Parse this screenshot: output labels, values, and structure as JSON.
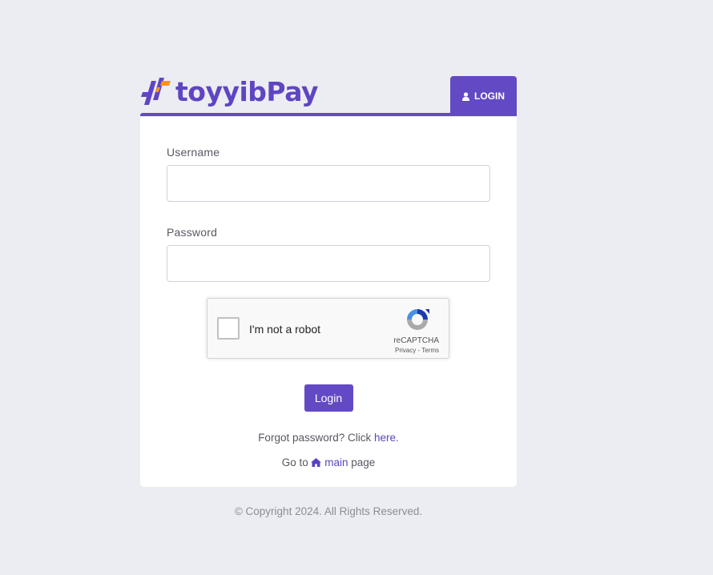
{
  "brand": {
    "name": "toyyibPay"
  },
  "header": {
    "login_tab_label": "LOGIN",
    "login_tab_icon": "user-icon"
  },
  "form": {
    "username_label": "Username",
    "username_value": "",
    "password_label": "Password",
    "password_value": "",
    "recaptcha": {
      "label": "I'm not a robot",
      "brand": "reCAPTCHA",
      "privacy": "Privacy",
      "separator": " - ",
      "terms": "Terms"
    },
    "submit_label": "Login"
  },
  "links": {
    "forgot_prefix": "Forgot password? Click ",
    "forgot_link": "here",
    "forgot_suffix": ".",
    "goto_prefix": "Go to ",
    "goto_link": "main",
    "goto_suffix": " page",
    "goto_icon": "home-icon"
  },
  "footer": {
    "copyright": "© Copyright 2024. All Rights Reserved."
  },
  "colors": {
    "accent": "#6449c4",
    "logo_orange": "#f7941d",
    "background": "#ebedf2"
  }
}
